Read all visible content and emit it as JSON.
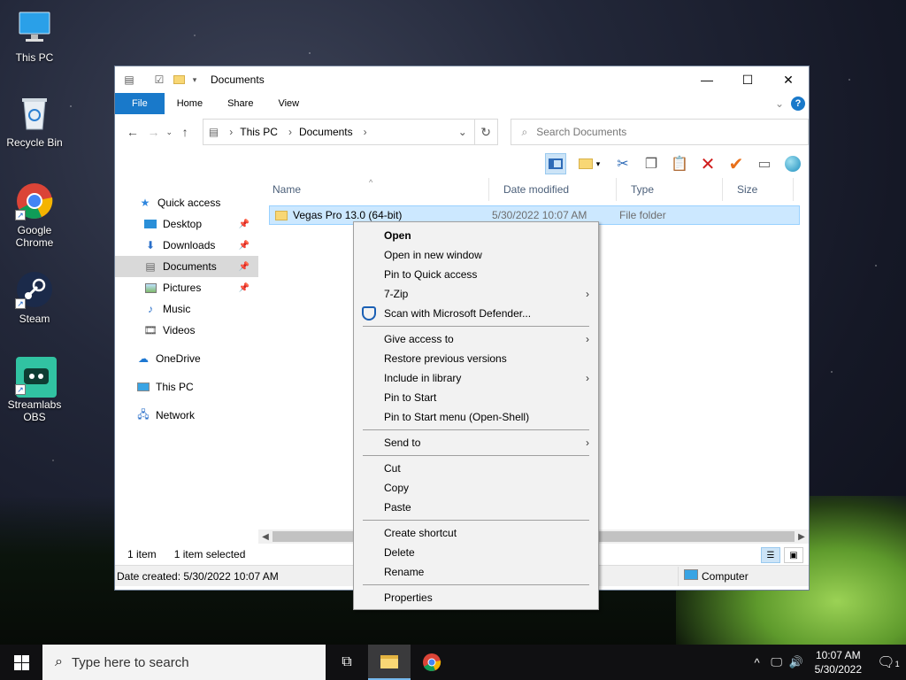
{
  "desktop": {
    "icons": [
      {
        "label": "This PC",
        "icon": "monitor-icon"
      },
      {
        "label": "Recycle Bin",
        "icon": "recycle-bin-icon"
      },
      {
        "label": "Google Chrome",
        "icon": "chrome-icon"
      },
      {
        "label": "Steam",
        "icon": "steam-icon"
      },
      {
        "label": "Streamlabs OBS",
        "icon": "streamlabs-icon"
      }
    ]
  },
  "explorer": {
    "title": "Documents",
    "tabs": {
      "file": "File",
      "home": "Home",
      "share": "Share",
      "view": "View"
    },
    "address": {
      "root": "This PC",
      "folder": "Documents"
    },
    "search_placeholder": "Search Documents",
    "nav": {
      "quick_access": "Quick access",
      "desktop": "Desktop",
      "downloads": "Downloads",
      "documents": "Documents",
      "pictures": "Pictures",
      "music": "Music",
      "videos": "Videos",
      "onedrive": "OneDrive",
      "this_pc": "This PC",
      "network": "Network"
    },
    "columns": {
      "name": "Name",
      "date": "Date modified",
      "type": "Type",
      "size": "Size"
    },
    "files": [
      {
        "name": "Vegas Pro 13.0 (64-bit)",
        "date": "5/30/2022 10:07 AM",
        "type": "File folder",
        "size": ""
      }
    ],
    "status": {
      "items": "1 item",
      "selected": "1 item selected"
    },
    "details": {
      "created": "Date created: 5/30/2022 10:07 AM",
      "location": "Computer"
    }
  },
  "context_menu": {
    "open": "Open",
    "open_new_window": "Open in new window",
    "pin_quick_access": "Pin to Quick access",
    "seven_zip": "7-Zip",
    "scan_defender": "Scan with Microsoft Defender...",
    "give_access": "Give access to",
    "restore_versions": "Restore previous versions",
    "include_library": "Include in library",
    "pin_start": "Pin to Start",
    "pin_start_openshell": "Pin to Start menu (Open-Shell)",
    "send_to": "Send to",
    "cut": "Cut",
    "copy": "Copy",
    "paste": "Paste",
    "create_shortcut": "Create shortcut",
    "delete": "Delete",
    "rename": "Rename",
    "properties": "Properties"
  },
  "taskbar": {
    "search_placeholder": "Type here to search",
    "time": "10:07 AM",
    "date": "5/30/2022",
    "notification_count": "1"
  }
}
